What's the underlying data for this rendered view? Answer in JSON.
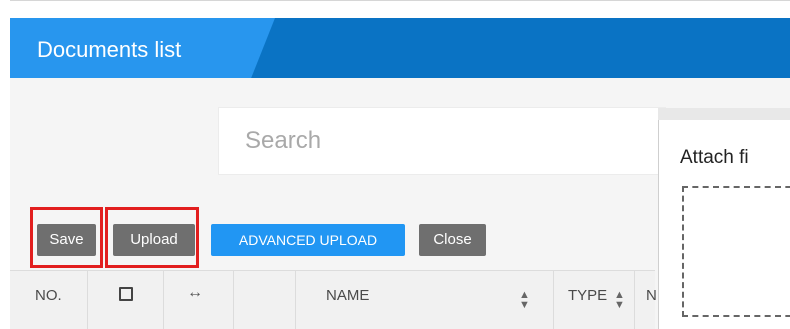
{
  "header": {
    "title": "Documents list"
  },
  "search": {
    "placeholder": "Search"
  },
  "toolbar": {
    "save_label": "Save",
    "upload_label": "Upload",
    "advanced_upload_label": "ADVANCED UPLOAD",
    "close_label": "Close"
  },
  "table": {
    "columns": {
      "no": "NO.",
      "select_icon": "checkbox-icon",
      "resize_icon": "resize-arrows-icon",
      "name": "NAME",
      "type": "TYPE",
      "next": "N"
    },
    "sort_icon": "sort-icon"
  },
  "modal": {
    "title": "Attach fi"
  },
  "colors": {
    "header_dark": "#0a73c4",
    "header_light": "#2896ee",
    "button_gray": "#6f6f6f",
    "button_blue": "#2196f3",
    "highlight": "#e21e1e"
  }
}
